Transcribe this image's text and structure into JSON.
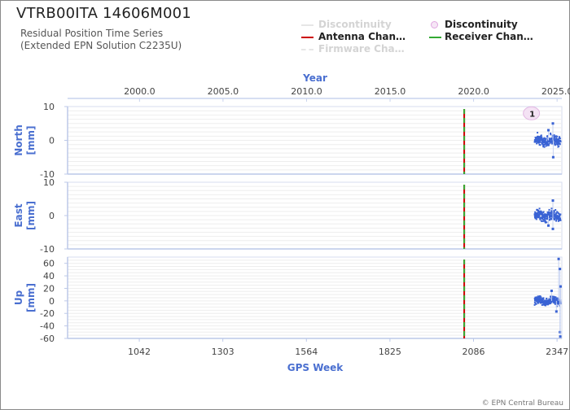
{
  "title": "VTRB00ITA 14606M001",
  "subtitle_line1": "Residual Position Time Series",
  "subtitle_line2": "(Extended EPN Solution C2235U)",
  "legend": [
    {
      "label": "Discontinuity",
      "kind": "line",
      "color": "#e6e6e6",
      "active": false
    },
    {
      "label": "Discontinuity",
      "kind": "dot",
      "color": "#e0a8e0",
      "active": true
    },
    {
      "label": "Antenna Chan…",
      "kind": "line",
      "color": "#cc0000",
      "active": true
    },
    {
      "label": "Receiver Chan…",
      "kind": "line",
      "color": "#33aa33",
      "active": true
    },
    {
      "label": "Firmware Cha…",
      "kind": "dash",
      "color": "#e6e6e6",
      "active": false
    }
  ],
  "copyright": "© EPN Central Bureau",
  "chart_data": {
    "type": "scatter",
    "top_axis": {
      "label": "Year",
      "ticks": [
        "2000.0",
        "2005.0",
        "2010.0",
        "2015.0",
        "2020.0",
        "2025.0"
      ]
    },
    "bottom_axis": {
      "label": "GPS Week",
      "ticks": [
        "1042",
        "1303",
        "1564",
        "1825",
        "2086",
        "2347"
      ],
      "range": [
        818,
        2362
      ]
    },
    "events": [
      {
        "type": "Antenna Change",
        "gps_week": 2057,
        "color": "#cc0000"
      },
      {
        "type": "Receiver Change",
        "gps_week": 2057,
        "color": "#33aa33"
      }
    ],
    "discontinuity_markers": [
      {
        "label": "1",
        "gps_week": 2267
      }
    ],
    "data_start_week": 2277,
    "data_end_week": 2358,
    "series_color": "#3a63d4",
    "panels": [
      {
        "name": "North",
        "unit": "[mm]",
        "ylim": [
          -10,
          10
        ],
        "ticks": [
          10,
          0,
          -10
        ],
        "summary": {
          "mean": 0,
          "spread": 1.2,
          "outliers": [
            [
              2334,
              5
            ],
            [
              2335,
              -5
            ],
            [
              2320,
              3
            ]
          ]
        }
      },
      {
        "name": "East",
        "unit": "[mm]",
        "ylim": [
          -10,
          10
        ],
        "ticks": [
          10,
          0,
          -10
        ],
        "summary": {
          "mean": 0,
          "spread": 1.2,
          "outliers": [
            [
              2334,
              4.5
            ],
            [
              2334,
              -4
            ],
            [
              2320,
              -3
            ]
          ]
        }
      },
      {
        "name": "Up",
        "unit": "[mm]",
        "ylim": [
          -60,
          70
        ],
        "ticks": [
          60,
          40,
          20,
          0,
          -20,
          -40,
          -60
        ],
        "summary": {
          "mean": 0,
          "spread": 5,
          "outliers": [
            [
              2352,
              67
            ],
            [
              2356,
              51
            ],
            [
              2358,
              23
            ],
            [
              2356,
              -50
            ],
            [
              2357,
              -57
            ],
            [
              2345,
              -17
            ],
            [
              2330,
              16
            ]
          ]
        }
      }
    ]
  }
}
